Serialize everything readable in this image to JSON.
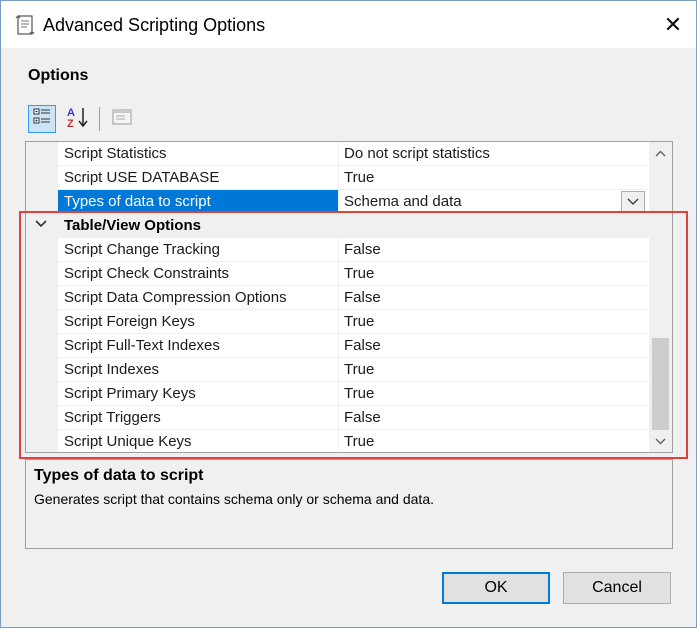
{
  "window": {
    "title": "Advanced Scripting Options",
    "close_glyph": "✕"
  },
  "section_label": "Options",
  "toolbar": {
    "buttons": [
      {
        "icon": "categorized-icon",
        "active": true
      },
      {
        "icon": "sort-alphabetical-icon",
        "active": false
      },
      {
        "icon": "property-pages-icon",
        "active": false
      }
    ]
  },
  "grid": {
    "rows_top": [
      {
        "name": "Script Statistics",
        "value": "Do not script statistics"
      },
      {
        "name": "Script USE DATABASE",
        "value": "True"
      },
      {
        "name": "Types of data to script",
        "value": "Schema and data",
        "selected": true
      }
    ],
    "category": {
      "name": "Table/View Options",
      "expanded": true
    },
    "rows_category": [
      {
        "name": "Script Change Tracking",
        "value": "False"
      },
      {
        "name": "Script Check Constraints",
        "value": "True"
      },
      {
        "name": "Script Data Compression Options",
        "value": "False"
      },
      {
        "name": "Script Foreign Keys",
        "value": "True"
      },
      {
        "name": "Script Full-Text Indexes",
        "value": "False"
      },
      {
        "name": "Script Indexes",
        "value": "True"
      },
      {
        "name": "Script Primary Keys",
        "value": "True"
      },
      {
        "name": "Script Triggers",
        "value": "False"
      },
      {
        "name": "Script Unique Keys",
        "value": "True"
      }
    ]
  },
  "description": {
    "title": "Types of data to script",
    "text": "Generates script that contains schema only or schema and data."
  },
  "buttons": {
    "ok": "OK",
    "cancel": "Cancel"
  },
  "colors": {
    "selection": "#0078d7",
    "highlight_box": "#e0423b"
  }
}
